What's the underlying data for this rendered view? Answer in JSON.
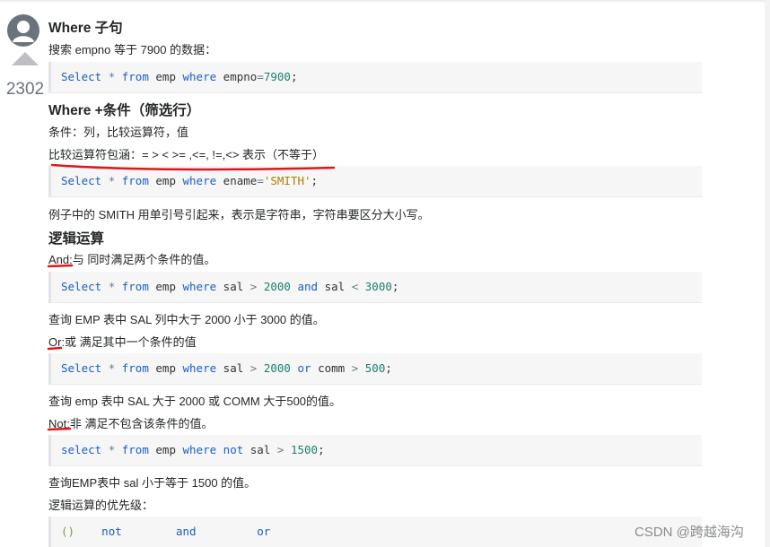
{
  "post": {
    "vote_count": "2302"
  },
  "sections": {
    "where_title": "Where 子句",
    "where_desc": "搜索 empno 等于 7900 的数据：",
    "code1": {
      "k1": "Select",
      "op1": "*",
      "k2": "from",
      "t1": "emp",
      "k3": "where",
      "t2": "empno",
      "op2": "=",
      "n1": "7900",
      "t3": ";"
    },
    "cond_title": "Where +条件（筛选行）",
    "cond_desc": "条件：列，比较运算符，值",
    "cond_ops": "比较运算符包涵：= > < >= ,<=, !=,<> 表示（不等于）",
    "code2": {
      "k1": "Select",
      "op1": "*",
      "k2": "from",
      "t1": "emp",
      "k3": "where",
      "t2": "ename",
      "op2": "=",
      "s1": "'SMITH'",
      "t3": ";"
    },
    "smith_note": "例子中的 SMITH 用单引号引起来，表示是字符串，字符串要区分大小写。",
    "logic_title": "逻辑运算",
    "and_desc": "And:与 同时满足两个条件的值。",
    "code3": {
      "k1": "Select",
      "op1": "*",
      "k2": "from",
      "t1": "emp",
      "k3": "where",
      "t2": "sal",
      "op2": ">",
      "n1": "2000",
      "k4": "and",
      "t3": "sal",
      "op3": "<",
      "n2": "3000",
      "t4": ";"
    },
    "and_note": "查询 EMP 表中 SAL 列中大于 2000 小于 3000 的值。",
    "or_desc": "Or:或 满足其中一个条件的值",
    "code4": {
      "k1": "Select",
      "op1": "*",
      "k2": "from",
      "t1": "emp",
      "k3": "where",
      "t2": "sal",
      "op2": ">",
      "n1": "2000",
      "k4": "or",
      "t3": "comm",
      "op3": ">",
      "n2": "500",
      "t4": ";"
    },
    "or_note": "查询 emp 表中 SAL 大于 2000 或 COMM 大于500的值。",
    "not_desc": "Not:非 满足不包含该条件的值。",
    "code5": {
      "k1": "select",
      "op1": "*",
      "k2": "from",
      "t1": "emp",
      "k3": "where",
      "k4": "not",
      "t2": "sal",
      "op2": ">",
      "n1": "1500",
      "t3": ";"
    },
    "not_note": "查询EMP表中 sal 小于等于 1500 的值。",
    "priority_title": "逻辑运算的优先级：",
    "code6": {
      "p": "()",
      "k1": "not",
      "k2": "and",
      "k3": "or"
    }
  },
  "watermark": "CSDN @跨越海沟",
  "colors": {
    "keyword": "#1b5ec2",
    "string": "#b07b00",
    "number": "#1b7f6f",
    "underline": "#e0161c"
  }
}
